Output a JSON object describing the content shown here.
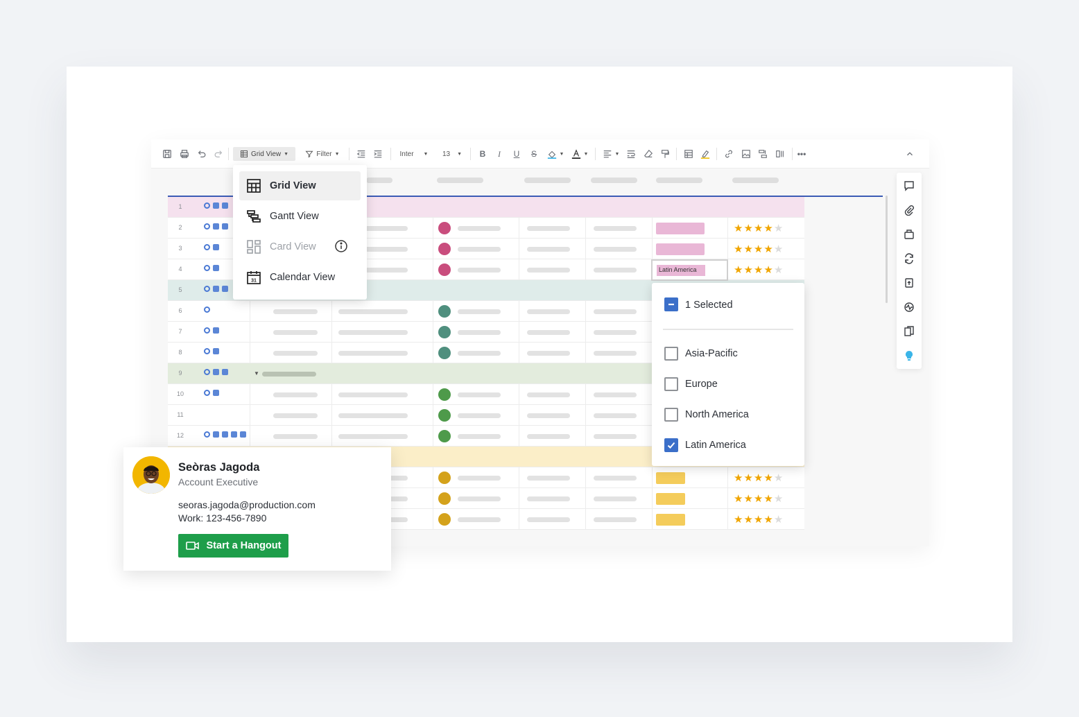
{
  "toolbar": {
    "view_label": "Grid View",
    "filter_label": "Filter",
    "font_label": "Inter",
    "size_label": "13"
  },
  "view_menu": {
    "items": [
      {
        "label": "Grid View",
        "icon": "grid-icon",
        "active": true
      },
      {
        "label": "Gantt View",
        "icon": "gantt-icon"
      },
      {
        "label": "Card View",
        "icon": "card-icon",
        "disabled": true
      },
      {
        "label": "Calendar View",
        "icon": "calendar-icon",
        "calendar_day": "31"
      }
    ]
  },
  "rows": [
    "1",
    "2",
    "3",
    "4",
    "5",
    "6",
    "7",
    "8",
    "9",
    "10",
    "11",
    "12"
  ],
  "selected_cell": "Latin America",
  "region_filter": {
    "summary": "1 Selected",
    "options": [
      {
        "label": "Asia-Pacific",
        "checked": false
      },
      {
        "label": "Europe",
        "checked": false
      },
      {
        "label": "North America",
        "checked": false
      },
      {
        "label": "Latin America",
        "checked": true
      }
    ]
  },
  "contact_card": {
    "name": "Seòras Jagoda",
    "role": "Account Executive",
    "email": "seoras.jagoda@production.com",
    "phone": "Work: 123-456-7890",
    "button_label": "Start a Hangout"
  },
  "ratings": {
    "scale": 5,
    "value": 4
  },
  "colors": {
    "accent": "#3b6fc9",
    "hangout_green": "#1e9e4a",
    "star": "#f0a500",
    "group_pink": "#f5e1ee",
    "group_teal": "#dfecea",
    "group_green": "#e3ecdd",
    "group_yellow": "#fbeec8"
  }
}
